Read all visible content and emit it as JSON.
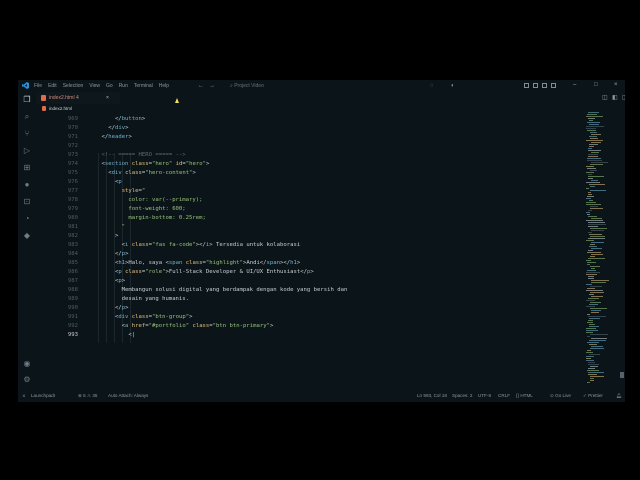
{
  "titlebar": {
    "menu": [
      "File",
      "Edit",
      "Selection",
      "View",
      "Go",
      "Run",
      "Terminal",
      "Help"
    ],
    "search_placeholder": "Project Video",
    "brand_color": "#2d8fd6"
  },
  "tabs": [
    {
      "label": "index2.html",
      "modified_marker": "4",
      "close": "×"
    }
  ],
  "breadcrumb": "index2.html",
  "editor": {
    "lines": [
      {
        "n": "969",
        "html": "        &lt;/<span class='tag'>button</span>&gt;"
      },
      {
        "n": "970",
        "html": "      &lt;/<span class='tag'>div</span>&gt;"
      },
      {
        "n": "971",
        "html": "    &lt;/<span class='tag'>header</span>&gt;"
      },
      {
        "n": "972",
        "html": ""
      },
      {
        "n": "973",
        "html": "    <span class='cmt'>&lt;!-- ===== HERO ===== --&gt;</span>"
      },
      {
        "n": "974",
        "html": "    &lt;<span class='tag'>section</span> <span class='attr'>class</span>=<span class='str'>\"hero\"</span> <span class='attr'>id</span>=<span class='str'>\"hero\"</span>&gt;"
      },
      {
        "n": "975",
        "html": "      &lt;<span class='tag'>div</span> <span class='attr'>class</span>=<span class='str'>\"hero-content\"</span>&gt;"
      },
      {
        "n": "976",
        "html": "        &lt;<span class='tag'>p</span>"
      },
      {
        "n": "977",
        "html": "          <span class='attr'>style</span>=<span class='str'>\"</span>"
      },
      {
        "n": "978",
        "html": "<span class='str'>            color: var(--primary);</span>"
      },
      {
        "n": "979",
        "html": "<span class='str'>            font-weight: 600;</span>"
      },
      {
        "n": "980",
        "html": "<span class='str'>            margin-bottom: 0.25rem;</span>"
      },
      {
        "n": "981",
        "html": "<span class='str'>          \"</span>"
      },
      {
        "n": "982",
        "html": "        &gt;"
      },
      {
        "n": "983",
        "html": "          &lt;<span class='tag'>i</span> <span class='attr'>class</span>=<span class='str'>\"fas fa-code\"</span>&gt;&lt;/<span class='tag'>i</span>&gt; Tersedia untuk kolaborasi"
      },
      {
        "n": "984",
        "html": "        &lt;/<span class='tag'>p</span>&gt;"
      },
      {
        "n": "985",
        "html": "        &lt;<span class='tag'>h1</span>&gt;Halo, saya &lt;<span class='tag'>span</span> <span class='attr'>class</span>=<span class='str'>\"highlight\"</span>&gt;Andi&lt;/<span class='tag'>span</span>&gt;&lt;/<span class='tag'>h1</span>&gt;"
      },
      {
        "n": "986",
        "html": "        &lt;<span class='tag'>p</span> <span class='attr'>class</span>=<span class='str'>\"role\"</span>&gt;Full-Stack Developer &amp; UI/UX Enthusiast&lt;/<span class='tag'>p</span>&gt;"
      },
      {
        "n": "987",
        "html": "        &lt;<span class='tag'>p</span>&gt;"
      },
      {
        "n": "988",
        "html": "          Membangun solusi digital yang berdampak dengan kode yang bersih dan"
      },
      {
        "n": "989",
        "html": "          desain yang humanis."
      },
      {
        "n": "990",
        "html": "        &lt;/<span class='tag'>p</span>&gt;"
      },
      {
        "n": "991",
        "html": "        &lt;<span class='tag'>div</span> <span class='attr'>class</span>=<span class='str'>\"btn-group\"</span>&gt;"
      },
      {
        "n": "992",
        "html": "          &lt;<span class='tag'>a</span> <span class='attr'>href</span>=<span class='str'>\"#portfolio\"</span> <span class='attr'>class</span>=<span class='str'>\"btn btn-primary\"</span>&gt;"
      },
      {
        "n": "993",
        "html": "            &lt;|"
      }
    ],
    "current_line": "993"
  },
  "statusbar": {
    "remote": "LaunchpadI",
    "problems": "⊗ 5 ⚠ 35",
    "auto_attach": "Auto Attach: Always",
    "position": "Ln 993, Col 18",
    "spaces": "Spaces: 2",
    "encoding": "UTF-8",
    "eol": "CRLF",
    "language": "{} HTML",
    "golive": "⊙ Go Live",
    "prettier": "✓ Prettier"
  }
}
